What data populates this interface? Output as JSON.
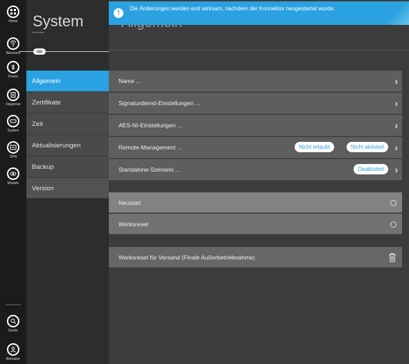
{
  "banner": {
    "text": "Die Änderungen werden erst wirksam, nachdem der Konnektor neugestartet wurde.",
    "icon": "info-icon"
  },
  "rail": [
    {
      "label": "Home",
      "icon": "home-grid-icon"
    },
    {
      "label": "Netzwerk",
      "icon": "network-icon"
    },
    {
      "label": "Praxis",
      "icon": "praxis-icon"
    },
    {
      "label": "Diagnose",
      "icon": "diagnose-icon"
    },
    {
      "label": "System",
      "icon": "system-icon"
    },
    {
      "label": "VPN",
      "icon": "vpn-icon"
    },
    {
      "label": "Module",
      "icon": "module-icon"
    },
    {
      "label": "Suche",
      "icon": "search-icon"
    },
    {
      "label": "Benutzer",
      "icon": "user-icon"
    }
  ],
  "section": {
    "title": "System",
    "subtitle": "konnektor"
  },
  "nav": [
    {
      "label": "Allgemein"
    },
    {
      "label": "Zertifikate"
    },
    {
      "label": "Zeit"
    },
    {
      "label": "Aktualisierungen"
    },
    {
      "label": "Backup"
    },
    {
      "label": "Version"
    }
  ],
  "main": {
    "title": "Allgemein",
    "rows": [
      {
        "label": "Name ..."
      },
      {
        "label": "Signaturdienst-Einstellungen ..."
      },
      {
        "label": "AES-NI-Einstellungen ..."
      },
      {
        "label": "Remote-Management ...",
        "badges": [
          "Nicht erlaubt",
          "Nicht aktiviert"
        ]
      },
      {
        "label": "Standalone-Szenario ...",
        "badges": [
          "Deaktiviert"
        ]
      }
    ],
    "actions": [
      {
        "label": "Neustart"
      },
      {
        "label": "Werksreset"
      }
    ],
    "factory_ship": {
      "label": "Werksreset für Versand (Finale Außerbetriebnahme)",
      "icon": "trash-icon"
    }
  },
  "colors": {
    "accent": "#2aa1e0",
    "rail": "#1b1b1b",
    "section": "#2d2d2d"
  }
}
